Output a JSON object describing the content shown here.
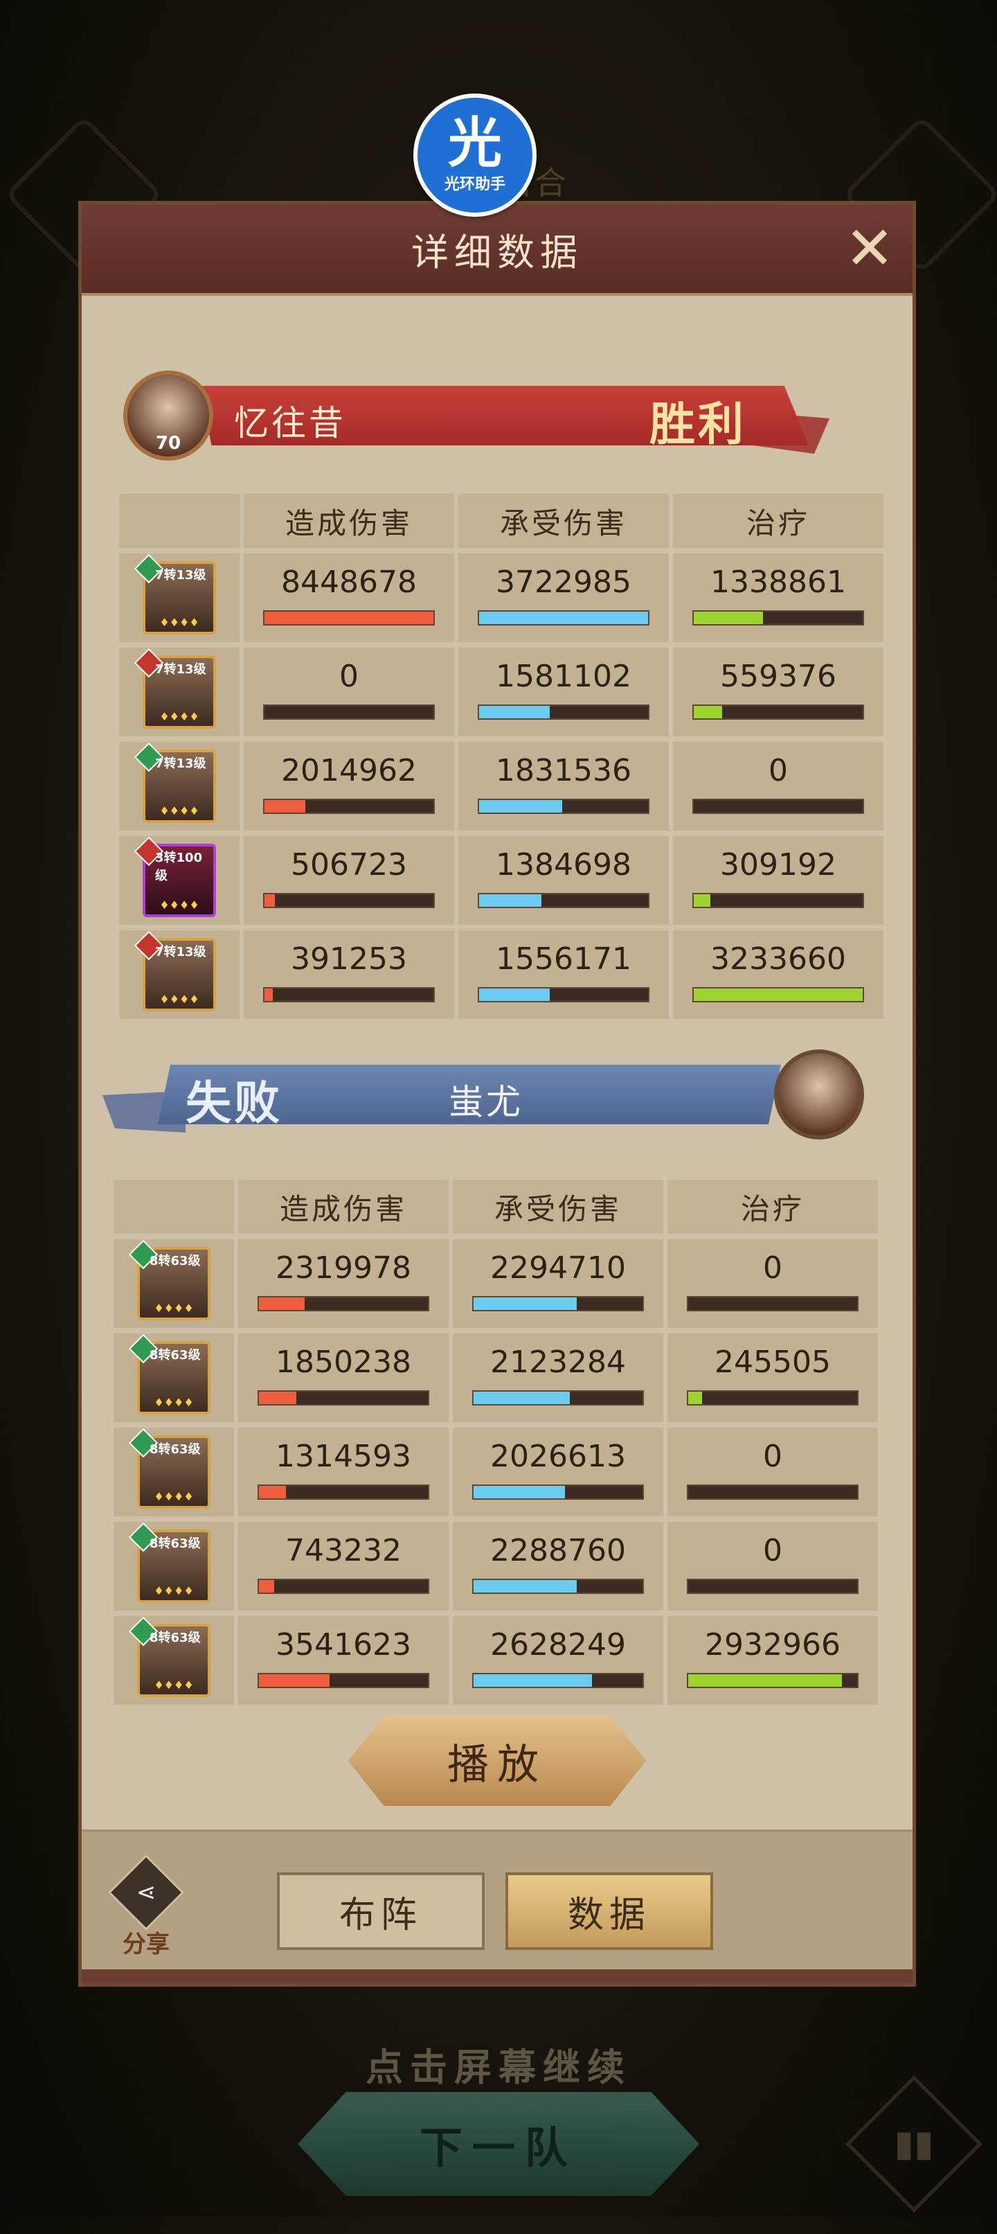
{
  "background": {
    "round_label": "第一回合",
    "continue_text": "点击屏幕继续",
    "next_team_button": "下一队",
    "stats_icon": "bar-chart-icon"
  },
  "watermark": {
    "main": "光",
    "sub": "光环助手"
  },
  "dialog": {
    "title": "详细数据",
    "close_icon": "close-icon",
    "play_button": "播放",
    "footer": {
      "share_label": "分享",
      "share_icon": "share-icon",
      "tab_formation": "布阵",
      "tab_data": "数据"
    }
  },
  "headers": {
    "damage_dealt": "造成伤害",
    "damage_taken": "承受伤害",
    "healing": "治疗"
  },
  "colors": {
    "damage_bar": "#ef5f3f",
    "taken_bar": "#6ccbf0",
    "heal_bar": "#9dd32f"
  },
  "team1": {
    "name": "忆往昔",
    "level": "70",
    "result": "胜利",
    "heroes": [
      {
        "tag": "7转13级",
        "damage": "8448678",
        "taken": "3722985",
        "heal": "1338861",
        "damage_frac": 1.0,
        "taken_frac": 1.0,
        "heal_frac": 0.41
      },
      {
        "tag": "7转13级",
        "damage": "0",
        "taken": "1581102",
        "heal": "559376",
        "damage_frac": 0.0,
        "taken_frac": 0.42,
        "heal_frac": 0.17
      },
      {
        "tag": "7转13级",
        "damage": "2014962",
        "taken": "1831536",
        "heal": "0",
        "damage_frac": 0.24,
        "taken_frac": 0.49,
        "heal_frac": 0.0
      },
      {
        "tag": "3转100级",
        "damage": "506723",
        "taken": "1384698",
        "heal": "309192",
        "damage_frac": 0.06,
        "taken_frac": 0.37,
        "heal_frac": 0.1
      },
      {
        "tag": "7转13级",
        "damage": "391253",
        "taken": "1556171",
        "heal": "3233660",
        "damage_frac": 0.05,
        "taken_frac": 0.42,
        "heal_frac": 1.0
      }
    ]
  },
  "team2": {
    "name": "蚩尤",
    "result": "失败",
    "heroes": [
      {
        "tag": "8转63级",
        "damage": "2319978",
        "taken": "2294710",
        "heal": "0",
        "damage_frac": 0.27,
        "taken_frac": 0.61,
        "heal_frac": 0.0
      },
      {
        "tag": "8转63级",
        "damage": "1850238",
        "taken": "2123284",
        "heal": "245505",
        "damage_frac": 0.22,
        "taken_frac": 0.57,
        "heal_frac": 0.08
      },
      {
        "tag": "8转63级",
        "damage": "1314593",
        "taken": "2026613",
        "heal": "0",
        "damage_frac": 0.16,
        "taken_frac": 0.54,
        "heal_frac": 0.0
      },
      {
        "tag": "8转63级",
        "damage": "743232",
        "taken": "2288760",
        "heal": "0",
        "damage_frac": 0.09,
        "taken_frac": 0.61,
        "heal_frac": 0.0
      },
      {
        "tag": "8转63级",
        "damage": "3541623",
        "taken": "2628249",
        "heal": "2932966",
        "damage_frac": 0.42,
        "taken_frac": 0.7,
        "heal_frac": 0.91
      }
    ]
  }
}
